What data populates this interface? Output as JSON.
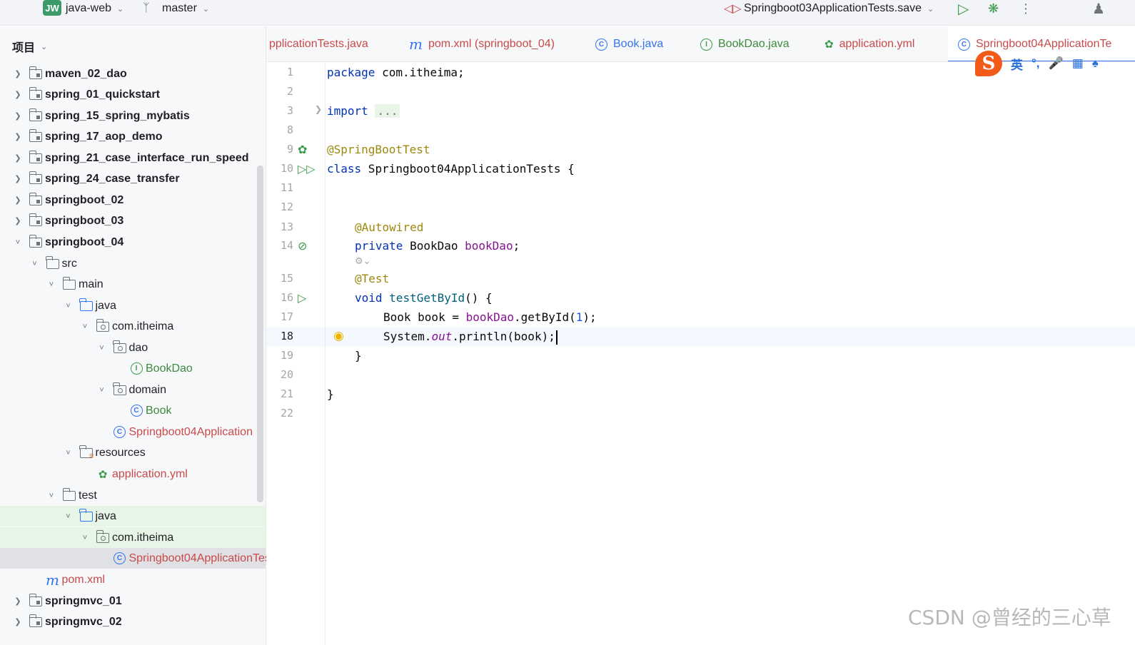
{
  "titlebar": {
    "project_badge": "JW",
    "project_name": "java-web",
    "branch": "master",
    "run_config": "Springboot03ApplicationTests.save"
  },
  "sidebar": {
    "header": "项目",
    "rows": [
      {
        "label": "maven_02_dao"
      },
      {
        "label": "spring_01_quickstart"
      },
      {
        "label": "spring_15_spring_mybatis"
      },
      {
        "label": "spring_17_aop_demo"
      },
      {
        "label": "spring_21_case_interface_run_speed"
      },
      {
        "label": "spring_24_case_transfer"
      },
      {
        "label": "springboot_02"
      },
      {
        "label": "springboot_03"
      },
      {
        "label": "springboot_04"
      },
      {
        "label": "src"
      },
      {
        "label": "main"
      },
      {
        "label": "java"
      },
      {
        "label": "com.itheima"
      },
      {
        "label": "dao"
      },
      {
        "label": "BookDao"
      },
      {
        "label": "domain"
      },
      {
        "label": "Book"
      },
      {
        "label": "Springboot04Application"
      },
      {
        "label": "resources"
      },
      {
        "label": "application.yml"
      },
      {
        "label": "test"
      },
      {
        "label": "java"
      },
      {
        "label": "com.itheima"
      },
      {
        "label": "Springboot04ApplicationTests"
      },
      {
        "label": "pom.xml"
      },
      {
        "label": "springmvc_01"
      },
      {
        "label": "springmvc_02"
      }
    ]
  },
  "tabs": [
    {
      "label": "pplicationTests.java"
    },
    {
      "label": "pom.xml (springboot_04)"
    },
    {
      "label": "Book.java"
    },
    {
      "label": "BookDao.java"
    },
    {
      "label": "application.yml"
    },
    {
      "label": "Springboot04ApplicationTe"
    }
  ],
  "editor": {
    "line_numbers": [
      "1",
      "2",
      "3",
      "8",
      "9",
      "10",
      "11",
      "12",
      "13",
      "14",
      "15",
      "16",
      "17",
      "18",
      "19",
      "20",
      "21",
      "22"
    ],
    "code": {
      "pkg_kw": "package",
      "pkg_name": " com.itheima;",
      "import_kw": "import",
      "import_fold": "...",
      "ann_sbt": "@SpringBootTest",
      "class_kw": "class",
      "class_name": " Springboot04ApplicationTests {",
      "ann_aw": "@Autowired",
      "private_kw": "private",
      "field_type": " BookDao ",
      "field_name": "bookDao",
      "semi": ";",
      "ann_test": "@Test",
      "void_kw": "void",
      "method_name": "testGetById",
      "method_rest": "() {",
      "l17_a": "Book book = ",
      "l17_b": "bookDao",
      "l17_c": ".getById(",
      "l17_num": "1",
      "l17_d": ");",
      "l18_a": "System.",
      "l18_out": "out",
      "l18_b": ".println(book);",
      "close_method": "}",
      "close_class": "}"
    }
  },
  "ime": {
    "lang": "英",
    "punct": "°,"
  },
  "watermark": "CSDN @曾经的三心草"
}
